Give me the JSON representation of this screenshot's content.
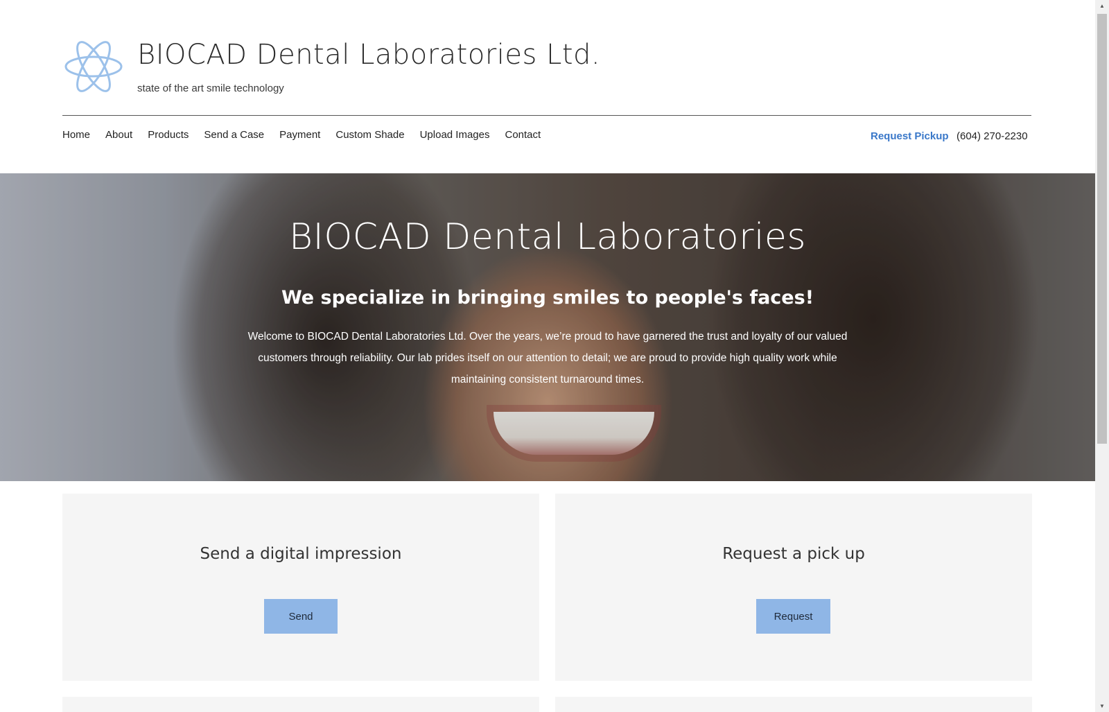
{
  "header": {
    "site_title": "BIOCAD Dental Laboratories Ltd.",
    "tagline": "state of the art smile technology",
    "logo_icon": "atom-icon"
  },
  "nav": {
    "items": [
      {
        "label": "Home"
      },
      {
        "label": "About"
      },
      {
        "label": "Products"
      },
      {
        "label": "Send a Case"
      },
      {
        "label": "Payment"
      },
      {
        "label": "Custom Shade"
      },
      {
        "label": "Upload Images"
      },
      {
        "label": "Contact"
      }
    ],
    "request_pickup": "Request Pickup",
    "phone": "(604) 270-2230"
  },
  "hero": {
    "title": "BIOCAD Dental Laboratories",
    "subtitle": "We specialize in bringing smiles to people's faces!",
    "body": "Welcome to BIOCAD Dental Laboratories Ltd. Over the years, we’re proud to have garnered the trust and loyalty of our valued customers through reliability. Our lab prides itself on our attention to detail; we are proud to provide high quality work while maintaining consistent turnaround times."
  },
  "cards": [
    {
      "title": "Send a digital impression",
      "button": "Send"
    },
    {
      "title": "Request a pick up",
      "button": "Request"
    }
  ],
  "colors": {
    "accent_link": "#3a78c9",
    "button_bg": "#8fb6e6",
    "card_bg": "#f5f5f5"
  }
}
